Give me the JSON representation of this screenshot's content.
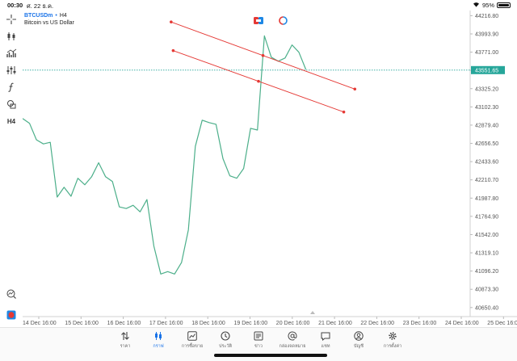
{
  "status": {
    "time": "00:30",
    "date": "ศ. 22 ธ.ค.",
    "battery": "95%"
  },
  "toolbar": {
    "timeframe": "H4"
  },
  "symbol": {
    "name": "BTCUSDm",
    "timeframe": "H4",
    "description": "Bitcoin vs US Dollar"
  },
  "current_price": "43551.65",
  "price_axis": [
    "44216.80",
    "43993.90",
    "43771.00",
    "43548.10",
    "43325.20",
    "43102.30",
    "42879.40",
    "42656.50",
    "42433.60",
    "42210.70",
    "41987.80",
    "41764.90",
    "41542.00",
    "41319.10",
    "41096.20",
    "40873.30",
    "40650.40"
  ],
  "time_axis": [
    "14 Dec 16:00",
    "15 Dec 16:00",
    "16 Dec 16:00",
    "17 Dec 16:00",
    "18 Dec 16:00",
    "19 Dec 16:00",
    "20 Dec 16:00",
    "21 Dec 16:00",
    "22 Dec 16:00",
    "23 Dec 16:00",
    "24 Dec 16:00",
    "25 Dec 16:00"
  ],
  "chart_data": {
    "type": "line",
    "series": [
      {
        "values": [
          42960,
          42900,
          42700,
          42650,
          42670,
          42000,
          42120,
          42010,
          42230,
          42150,
          42250,
          42420,
          42250,
          42190,
          41880,
          41860,
          41900,
          41820,
          41970,
          41400,
          41060,
          41090,
          41060,
          41200,
          41600,
          42620,
          42940,
          42910,
          42890,
          42470,
          42260,
          42230,
          42350,
          42840,
          42820,
          43970,
          43710,
          43660,
          43700,
          43860,
          43770,
          43560
        ]
      }
    ],
    "ylim": [
      40540,
      44280
    ],
    "trendlines": [
      {
        "color": "#e53935",
        "start": [
          21.5,
          44140
        ],
        "end": [
          48.1,
          43320
        ]
      },
      {
        "color": "#e53935",
        "start": [
          21.8,
          43790
        ],
        "end": [
          46.5,
          43040
        ]
      }
    ],
    "colors": {
      "line": "#4caf8a",
      "current_price": "#26a69a",
      "trendline": "#e53935"
    }
  },
  "nav": [
    {
      "label": "ราคา",
      "icon": "quotes-icon"
    },
    {
      "label": "กราฟ",
      "icon": "chart-icon",
      "active": true
    },
    {
      "label": "การซื้อขาย",
      "icon": "trade-icon"
    },
    {
      "label": "ประวัติ",
      "icon": "history-icon"
    },
    {
      "label": "ข่าว",
      "icon": "news-icon"
    },
    {
      "label": "กล่องจดหมาย",
      "icon": "mailbox-icon"
    },
    {
      "label": "แชท",
      "icon": "chat-icon"
    },
    {
      "label": "บัญชี",
      "icon": "account-icon"
    },
    {
      "label": "การตั้งค่า",
      "icon": "settings-icon"
    }
  ]
}
